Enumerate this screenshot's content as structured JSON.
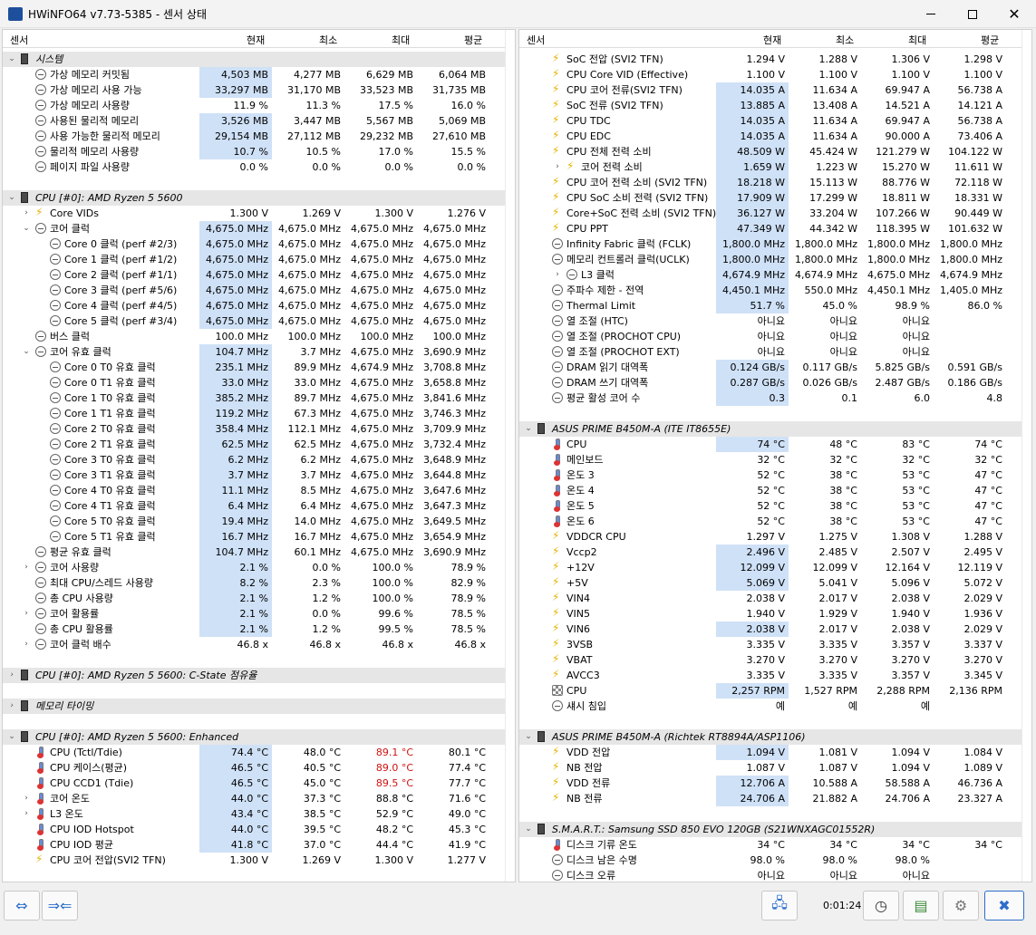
{
  "window": {
    "title": "HWiNFO64 v7.73-5385 - 센서 상태"
  },
  "columns": {
    "sensor": "센서",
    "cur": "현재",
    "min": "최소",
    "max": "최대",
    "avg": "평균"
  },
  "left_rows": [
    {
      "t": "g",
      "tw": "v",
      "label": "시스템"
    },
    {
      "i": "clock",
      "d": 1,
      "label": "가상 메모리 커밋됨",
      "cur": "4,503 MB",
      "min": "4,277 MB",
      "max": "6,629 MB",
      "avg": "6,064 MB",
      "hl": true
    },
    {
      "i": "clock",
      "d": 1,
      "label": "가상 메모리 사용 가능",
      "cur": "33,297 MB",
      "min": "31,170 MB",
      "max": "33,523 MB",
      "avg": "31,735 MB",
      "hl": true
    },
    {
      "i": "clock",
      "d": 1,
      "label": "가상 메모리 사용량",
      "cur": "11.9 %",
      "min": "11.3 %",
      "max": "17.5 %",
      "avg": "16.0 %"
    },
    {
      "i": "clock",
      "d": 1,
      "label": "사용된 물리적 메모리",
      "cur": "3,526 MB",
      "min": "3,447 MB",
      "max": "5,567 MB",
      "avg": "5,069 MB",
      "hl": true
    },
    {
      "i": "clock",
      "d": 1,
      "label": "사용 가능한 물리적 메모리",
      "cur": "29,154 MB",
      "min": "27,112 MB",
      "max": "29,232 MB",
      "avg": "27,610 MB",
      "hl": true
    },
    {
      "i": "clock",
      "d": 1,
      "label": "물리적 메모리 사용량",
      "cur": "10.7 %",
      "min": "10.5 %",
      "max": "17.0 %",
      "avg": "15.5 %",
      "hl": true
    },
    {
      "i": "clock",
      "d": 1,
      "label": "페이지 파일 사용량",
      "cur": "0.0 %",
      "min": "0.0 %",
      "max": "0.0 %",
      "avg": "0.0 %"
    },
    {
      "t": "s"
    },
    {
      "t": "g",
      "tw": "v",
      "label": "CPU [#0]: AMD Ryzen 5 5600"
    },
    {
      "i": "bolt",
      "d": 1,
      "tw": ">",
      "label": "Core VIDs",
      "cur": "1.300 V",
      "min": "1.269 V",
      "max": "1.300 V",
      "avg": "1.276 V"
    },
    {
      "i": "clock",
      "d": 1,
      "tw": "v",
      "label": "코어 클럭",
      "cur": "4,675.0 MHz",
      "min": "4,675.0 MHz",
      "max": "4,675.0 MHz",
      "avg": "4,675.0 MHz",
      "hl": true
    },
    {
      "i": "clock",
      "d": 2,
      "label": "Core 0 클럭 (perf #2/3)",
      "cur": "4,675.0 MHz",
      "min": "4,675.0 MHz",
      "max": "4,675.0 MHz",
      "avg": "4,675.0 MHz",
      "hl": true
    },
    {
      "i": "clock",
      "d": 2,
      "label": "Core 1 클럭 (perf #1/2)",
      "cur": "4,675.0 MHz",
      "min": "4,675.0 MHz",
      "max": "4,675.0 MHz",
      "avg": "4,675.0 MHz",
      "hl": true
    },
    {
      "i": "clock",
      "d": 2,
      "label": "Core 2 클럭 (perf #1/1)",
      "cur": "4,675.0 MHz",
      "min": "4,675.0 MHz",
      "max": "4,675.0 MHz",
      "avg": "4,675.0 MHz",
      "hl": true
    },
    {
      "i": "clock",
      "d": 2,
      "label": "Core 3 클럭 (perf #5/6)",
      "cur": "4,675.0 MHz",
      "min": "4,675.0 MHz",
      "max": "4,675.0 MHz",
      "avg": "4,675.0 MHz",
      "hl": true
    },
    {
      "i": "clock",
      "d": 2,
      "label": "Core 4 클럭 (perf #4/5)",
      "cur": "4,675.0 MHz",
      "min": "4,675.0 MHz",
      "max": "4,675.0 MHz",
      "avg": "4,675.0 MHz",
      "hl": true
    },
    {
      "i": "clock",
      "d": 2,
      "label": "Core 5 클럭 (perf #3/4)",
      "cur": "4,675.0 MHz",
      "min": "4,675.0 MHz",
      "max": "4,675.0 MHz",
      "avg": "4,675.0 MHz",
      "hl": true
    },
    {
      "i": "clock",
      "d": 1,
      "label": "버스 클럭",
      "cur": "100.0 MHz",
      "min": "100.0 MHz",
      "max": "100.0 MHz",
      "avg": "100.0 MHz"
    },
    {
      "i": "clock",
      "d": 1,
      "tw": "v",
      "label": "코어 유효 클럭",
      "cur": "104.7 MHz",
      "min": "3.7 MHz",
      "max": "4,675.0 MHz",
      "avg": "3,690.9 MHz",
      "hl": true
    },
    {
      "i": "clock",
      "d": 2,
      "label": "Core 0 T0 유효 클럭",
      "cur": "235.1 MHz",
      "min": "89.9 MHz",
      "max": "4,674.9 MHz",
      "avg": "3,708.8 MHz",
      "hl": true
    },
    {
      "i": "clock",
      "d": 2,
      "label": "Core 0 T1 유효 클럭",
      "cur": "33.0 MHz",
      "min": "33.0 MHz",
      "max": "4,675.0 MHz",
      "avg": "3,658.8 MHz",
      "hl": true
    },
    {
      "i": "clock",
      "d": 2,
      "label": "Core 1 T0 유효 클럭",
      "cur": "385.2 MHz",
      "min": "89.7 MHz",
      "max": "4,675.0 MHz",
      "avg": "3,841.6 MHz",
      "hl": true
    },
    {
      "i": "clock",
      "d": 2,
      "label": "Core 1 T1 유효 클럭",
      "cur": "119.2 MHz",
      "min": "67.3 MHz",
      "max": "4,675.0 MHz",
      "avg": "3,746.3 MHz",
      "hl": true
    },
    {
      "i": "clock",
      "d": 2,
      "label": "Core 2 T0 유효 클럭",
      "cur": "358.4 MHz",
      "min": "112.1 MHz",
      "max": "4,675.0 MHz",
      "avg": "3,709.9 MHz",
      "hl": true
    },
    {
      "i": "clock",
      "d": 2,
      "label": "Core 2 T1 유효 클럭",
      "cur": "62.5 MHz",
      "min": "62.5 MHz",
      "max": "4,675.0 MHz",
      "avg": "3,732.4 MHz",
      "hl": true
    },
    {
      "i": "clock",
      "d": 2,
      "label": "Core 3 T0 유효 클럭",
      "cur": "6.2 MHz",
      "min": "6.2 MHz",
      "max": "4,675.0 MHz",
      "avg": "3,648.9 MHz",
      "hl": true
    },
    {
      "i": "clock",
      "d": 2,
      "label": "Core 3 T1 유효 클럭",
      "cur": "3.7 MHz",
      "min": "3.7 MHz",
      "max": "4,675.0 MHz",
      "avg": "3,644.8 MHz",
      "hl": true
    },
    {
      "i": "clock",
      "d": 2,
      "label": "Core 4 T0 유효 클럭",
      "cur": "11.1 MHz",
      "min": "8.5 MHz",
      "max": "4,675.0 MHz",
      "avg": "3,647.6 MHz",
      "hl": true
    },
    {
      "i": "clock",
      "d": 2,
      "label": "Core 4 T1 유효 클럭",
      "cur": "6.4 MHz",
      "min": "6.4 MHz",
      "max": "4,675.0 MHz",
      "avg": "3,647.3 MHz",
      "hl": true
    },
    {
      "i": "clock",
      "d": 2,
      "label": "Core 5 T0 유효 클럭",
      "cur": "19.4 MHz",
      "min": "14.0 MHz",
      "max": "4,675.0 MHz",
      "avg": "3,649.5 MHz",
      "hl": true
    },
    {
      "i": "clock",
      "d": 2,
      "label": "Core 5 T1 유효 클럭",
      "cur": "16.7 MHz",
      "min": "16.7 MHz",
      "max": "4,675.0 MHz",
      "avg": "3,654.9 MHz",
      "hl": true
    },
    {
      "i": "clock",
      "d": 1,
      "label": "평균 유효 클럭",
      "cur": "104.7 MHz",
      "min": "60.1 MHz",
      "max": "4,675.0 MHz",
      "avg": "3,690.9 MHz",
      "hl": true
    },
    {
      "i": "clock",
      "d": 1,
      "tw": ">",
      "label": "코어 사용량",
      "cur": "2.1 %",
      "min": "0.0 %",
      "max": "100.0 %",
      "avg": "78.9 %",
      "hl": true
    },
    {
      "i": "clock",
      "d": 1,
      "label": "최대 CPU/스레드 사용량",
      "cur": "8.2 %",
      "min": "2.3 %",
      "max": "100.0 %",
      "avg": "82.9 %",
      "hl": true
    },
    {
      "i": "clock",
      "d": 1,
      "label": "총 CPU 사용량",
      "cur": "2.1 %",
      "min": "1.2 %",
      "max": "100.0 %",
      "avg": "78.9 %",
      "hl": true
    },
    {
      "i": "clock",
      "d": 1,
      "tw": ">",
      "label": "코어 활용률",
      "cur": "2.1 %",
      "min": "0.0 %",
      "max": "99.6 %",
      "avg": "78.5 %",
      "hl": true
    },
    {
      "i": "clock",
      "d": 1,
      "label": "총 CPU 활용률",
      "cur": "2.1 %",
      "min": "1.2 %",
      "max": "99.5 %",
      "avg": "78.5 %",
      "hl": true
    },
    {
      "i": "clock",
      "d": 1,
      "tw": ">",
      "label": "코어 클럭 배수",
      "cur": "46.8 x",
      "min": "46.8 x",
      "max": "46.8 x",
      "avg": "46.8 x"
    },
    {
      "t": "s"
    },
    {
      "t": "g",
      "tw": ">",
      "label": "CPU [#0]: AMD Ryzen 5 5600: C-State 점유율"
    },
    {
      "t": "s"
    },
    {
      "t": "g",
      "tw": ">",
      "label": "메모리 타이밍"
    },
    {
      "t": "s"
    },
    {
      "t": "g",
      "tw": "v",
      "label": "CPU [#0]: AMD Ryzen 5 5600: Enhanced"
    },
    {
      "i": "therm",
      "d": 1,
      "label": "CPU (Tctl/Tdie)",
      "cur": "74.4 °C",
      "min": "48.0 °C",
      "max": "89.1 °C",
      "avg": "80.1 °C",
      "hl": true,
      "mxr": true
    },
    {
      "i": "therm",
      "d": 1,
      "label": "CPU 케이스(평균)",
      "cur": "46.5 °C",
      "min": "40.5 °C",
      "max": "89.0 °C",
      "avg": "77.4 °C",
      "hl": true,
      "mxr": true
    },
    {
      "i": "therm",
      "d": 1,
      "label": "CPU CCD1 (Tdie)",
      "cur": "46.5 °C",
      "min": "45.0 °C",
      "max": "89.5 °C",
      "avg": "77.7 °C",
      "hl": true,
      "mxr": true
    },
    {
      "i": "therm",
      "d": 1,
      "tw": ">",
      "label": "코어 온도",
      "cur": "44.0 °C",
      "min": "37.3 °C",
      "max": "88.8 °C",
      "avg": "71.6 °C",
      "hl": true
    },
    {
      "i": "therm",
      "d": 1,
      "tw": ">",
      "label": "L3 온도",
      "cur": "43.4 °C",
      "min": "38.5 °C",
      "max": "52.9 °C",
      "avg": "49.0 °C",
      "hl": true
    },
    {
      "i": "therm",
      "d": 1,
      "label": "CPU IOD Hotspot",
      "cur": "44.0 °C",
      "min": "39.5 °C",
      "max": "48.2 °C",
      "avg": "45.3 °C",
      "hl": true
    },
    {
      "i": "therm",
      "d": 1,
      "label": "CPU IOD 평균",
      "cur": "41.8 °C",
      "min": "37.0 °C",
      "max": "44.4 °C",
      "avg": "41.9 °C",
      "hl": true
    },
    {
      "i": "bolt",
      "d": 1,
      "label": "CPU 코어 전압(SVI2 TFN)",
      "cur": "1.300 V",
      "min": "1.269 V",
      "max": "1.300 V",
      "avg": "1.277 V"
    }
  ],
  "right_rows": [
    {
      "i": "bolt",
      "d": 1,
      "label": "SoC 전압 (SVI2 TFN)",
      "cur": "1.294 V",
      "min": "1.288 V",
      "max": "1.306 V",
      "avg": "1.298 V"
    },
    {
      "i": "bolt",
      "d": 1,
      "label": "CPU Core VID (Effective)",
      "cur": "1.100 V",
      "min": "1.100 V",
      "max": "1.100 V",
      "avg": "1.100 V"
    },
    {
      "i": "bolt",
      "d": 1,
      "label": "CPU 코어 전류(SVI2 TFN)",
      "cur": "14.035 A",
      "min": "11.634 A",
      "max": "69.947 A",
      "avg": "56.738 A",
      "hl": true
    },
    {
      "i": "bolt",
      "d": 1,
      "label": "SoC 전류 (SVI2 TFN)",
      "cur": "13.885 A",
      "min": "13.408 A",
      "max": "14.521 A",
      "avg": "14.121 A",
      "hl": true
    },
    {
      "i": "bolt",
      "d": 1,
      "label": "CPU TDC",
      "cur": "14.035 A",
      "min": "11.634 A",
      "max": "69.947 A",
      "avg": "56.738 A",
      "hl": true
    },
    {
      "i": "bolt",
      "d": 1,
      "label": "CPU EDC",
      "cur": "14.035 A",
      "min": "11.634 A",
      "max": "90.000 A",
      "avg": "73.406 A",
      "hl": true
    },
    {
      "i": "bolt",
      "d": 1,
      "label": "CPU 전체 전력 소비",
      "cur": "48.509 W",
      "min": "45.424 W",
      "max": "121.279 W",
      "avg": "104.122 W",
      "hl": true
    },
    {
      "i": "bolt",
      "d": 2,
      "tw": ">",
      "label": "코어 전력 소비",
      "cur": "1.659 W",
      "min": "1.223 W",
      "max": "15.270 W",
      "avg": "11.611 W",
      "hl": true
    },
    {
      "i": "bolt",
      "d": 1,
      "label": "CPU 코어 전력 소비 (SVI2 TFN)",
      "cur": "18.218 W",
      "min": "15.113 W",
      "max": "88.776 W",
      "avg": "72.118 W",
      "hl": true
    },
    {
      "i": "bolt",
      "d": 1,
      "label": "CPU SoC 소비 전력 (SVI2 TFN)",
      "cur": "17.909 W",
      "min": "17.299 W",
      "max": "18.811 W",
      "avg": "18.331 W",
      "hl": true
    },
    {
      "i": "bolt",
      "d": 1,
      "label": "Core+SoC 전력 소비 (SVI2 TFN)",
      "cur": "36.127 W",
      "min": "33.204 W",
      "max": "107.266 W",
      "avg": "90.449 W",
      "hl": true
    },
    {
      "i": "bolt",
      "d": 1,
      "label": "CPU PPT",
      "cur": "47.349 W",
      "min": "44.342 W",
      "max": "118.395 W",
      "avg": "101.632 W",
      "hl": true
    },
    {
      "i": "clock",
      "d": 1,
      "label": "Infinity Fabric 클럭 (FCLK)",
      "cur": "1,800.0 MHz",
      "min": "1,800.0 MHz",
      "max": "1,800.0 MHz",
      "avg": "1,800.0 MHz",
      "hl": true
    },
    {
      "i": "clock",
      "d": 1,
      "label": "메모리 컨트롤러 클럭(UCLK)",
      "cur": "1,800.0 MHz",
      "min": "1,800.0 MHz",
      "max": "1,800.0 MHz",
      "avg": "1,800.0 MHz",
      "hl": true
    },
    {
      "i": "clock",
      "d": 2,
      "tw": ">",
      "label": "L3 클럭",
      "cur": "4,674.9 MHz",
      "min": "4,674.9 MHz",
      "max": "4,675.0 MHz",
      "avg": "4,674.9 MHz",
      "hl": true
    },
    {
      "i": "clock",
      "d": 1,
      "label": "주파수 제한 - 전역",
      "cur": "4,450.1 MHz",
      "min": "550.0 MHz",
      "max": "4,450.1 MHz",
      "avg": "1,405.0 MHz",
      "hl": true
    },
    {
      "i": "clock",
      "d": 1,
      "label": "Thermal Limit",
      "cur": "51.7 %",
      "min": "45.0 %",
      "max": "98.9 %",
      "avg": "86.0 %",
      "hl": true
    },
    {
      "i": "clock",
      "d": 1,
      "label": "열 조절 (HTC)",
      "cur": "아니요",
      "min": "아니요",
      "max": "아니요",
      "avg": ""
    },
    {
      "i": "clock",
      "d": 1,
      "label": "열 조절 (PROCHOT CPU)",
      "cur": "아니요",
      "min": "아니요",
      "max": "아니요",
      "avg": ""
    },
    {
      "i": "clock",
      "d": 1,
      "label": "열 조절 (PROCHOT EXT)",
      "cur": "아니요",
      "min": "아니요",
      "max": "아니요",
      "avg": ""
    },
    {
      "i": "clock",
      "d": 1,
      "label": "DRAM 읽기 대역폭",
      "cur": "0.124 GB/s",
      "min": "0.117 GB/s",
      "max": "5.825 GB/s",
      "avg": "0.591 GB/s",
      "hl": true
    },
    {
      "i": "clock",
      "d": 1,
      "label": "DRAM 쓰기 대역폭",
      "cur": "0.287 GB/s",
      "min": "0.026 GB/s",
      "max": "2.487 GB/s",
      "avg": "0.186 GB/s",
      "hl": true
    },
    {
      "i": "clock",
      "d": 1,
      "label": "평균 활성 코어 수",
      "cur": "0.3",
      "min": "0.1",
      "max": "6.0",
      "avg": "4.8",
      "hl": true
    },
    {
      "t": "s"
    },
    {
      "t": "g",
      "tw": "v",
      "label": "ASUS PRIME B450M-A (ITE IT8655E)"
    },
    {
      "i": "therm",
      "d": 1,
      "label": "CPU",
      "cur": "74 °C",
      "min": "48 °C",
      "max": "83 °C",
      "avg": "74 °C",
      "hl": true
    },
    {
      "i": "therm",
      "d": 1,
      "label": "메인보드",
      "cur": "32 °C",
      "min": "32 °C",
      "max": "32 °C",
      "avg": "32 °C"
    },
    {
      "i": "therm",
      "d": 1,
      "label": "온도 3",
      "cur": "52 °C",
      "min": "38 °C",
      "max": "53 °C",
      "avg": "47 °C"
    },
    {
      "i": "therm",
      "d": 1,
      "label": "온도 4",
      "cur": "52 °C",
      "min": "38 °C",
      "max": "53 °C",
      "avg": "47 °C"
    },
    {
      "i": "therm",
      "d": 1,
      "label": "온도 5",
      "cur": "52 °C",
      "min": "38 °C",
      "max": "53 °C",
      "avg": "47 °C"
    },
    {
      "i": "therm",
      "d": 1,
      "label": "온도 6",
      "cur": "52 °C",
      "min": "38 °C",
      "max": "53 °C",
      "avg": "47 °C"
    },
    {
      "i": "bolt",
      "d": 1,
      "label": "VDDCR CPU",
      "cur": "1.297 V",
      "min": "1.275 V",
      "max": "1.308 V",
      "avg": "1.288 V"
    },
    {
      "i": "bolt",
      "d": 1,
      "label": "Vccp2",
      "cur": "2.496 V",
      "min": "2.485 V",
      "max": "2.507 V",
      "avg": "2.495 V",
      "hl": true
    },
    {
      "i": "bolt",
      "d": 1,
      "label": "+12V",
      "cur": "12.099 V",
      "min": "12.099 V",
      "max": "12.164 V",
      "avg": "12.119 V",
      "hl": true
    },
    {
      "i": "bolt",
      "d": 1,
      "label": "+5V",
      "cur": "5.069 V",
      "min": "5.041 V",
      "max": "5.096 V",
      "avg": "5.072 V",
      "hl": true
    },
    {
      "i": "bolt",
      "d": 1,
      "label": "VIN4",
      "cur": "2.038 V",
      "min": "2.017 V",
      "max": "2.038 V",
      "avg": "2.029 V"
    },
    {
      "i": "bolt",
      "d": 1,
      "label": "VIN5",
      "cur": "1.940 V",
      "min": "1.929 V",
      "max": "1.940 V",
      "avg": "1.936 V"
    },
    {
      "i": "bolt",
      "d": 1,
      "label": "VIN6",
      "cur": "2.038 V",
      "min": "2.017 V",
      "max": "2.038 V",
      "avg": "2.029 V",
      "hl": true
    },
    {
      "i": "bolt",
      "d": 1,
      "label": "3VSB",
      "cur": "3.335 V",
      "min": "3.335 V",
      "max": "3.357 V",
      "avg": "3.337 V"
    },
    {
      "i": "bolt",
      "d": 1,
      "label": "VBAT",
      "cur": "3.270 V",
      "min": "3.270 V",
      "max": "3.270 V",
      "avg": "3.270 V"
    },
    {
      "i": "bolt",
      "d": 1,
      "label": "AVCC3",
      "cur": "3.335 V",
      "min": "3.335 V",
      "max": "3.357 V",
      "avg": "3.345 V"
    },
    {
      "i": "fan",
      "d": 1,
      "label": "CPU",
      "cur": "2,257 RPM",
      "min": "1,527 RPM",
      "max": "2,288 RPM",
      "avg": "2,136 RPM",
      "hl": true
    },
    {
      "i": "clock",
      "d": 1,
      "label": "섀시 침입",
      "cur": "예",
      "min": "예",
      "max": "예",
      "avg": ""
    },
    {
      "t": "s"
    },
    {
      "t": "g",
      "tw": "v",
      "label": "ASUS PRIME B450M-A (Richtek RT8894A/ASP1106)"
    },
    {
      "i": "bolt",
      "d": 1,
      "label": "VDD 전압",
      "cur": "1.094 V",
      "min": "1.081 V",
      "max": "1.094 V",
      "avg": "1.084 V",
      "hl": true
    },
    {
      "i": "bolt",
      "d": 1,
      "label": "NB 전압",
      "cur": "1.087 V",
      "min": "1.087 V",
      "max": "1.094 V",
      "avg": "1.089 V"
    },
    {
      "i": "bolt",
      "d": 1,
      "label": "VDD 전류",
      "cur": "12.706 A",
      "min": "10.588 A",
      "max": "58.588 A",
      "avg": "46.736 A",
      "hl": true
    },
    {
      "i": "bolt",
      "d": 1,
      "label": "NB 전류",
      "cur": "24.706 A",
      "min": "21.882 A",
      "max": "24.706 A",
      "avg": "23.327 A",
      "hl": true
    },
    {
      "t": "s"
    },
    {
      "t": "g",
      "tw": "v",
      "label": "S.M.A.R.T.: Samsung SSD 850 EVO 120GB (S21WNXAGC01552R)"
    },
    {
      "i": "therm",
      "d": 1,
      "label": "디스크 기류 온도",
      "cur": "34 °C",
      "min": "34 °C",
      "max": "34 °C",
      "avg": "34 °C"
    },
    {
      "i": "clock",
      "d": 1,
      "label": "디스크 남은 수명",
      "cur": "98.0 %",
      "min": "98.0 %",
      "max": "98.0 %",
      "avg": ""
    },
    {
      "i": "clock",
      "d": 1,
      "label": "디스크 오류",
      "cur": "아니요",
      "min": "아니요",
      "max": "아니요",
      "avg": ""
    }
  ],
  "footer": {
    "timer": "0:01:24"
  }
}
